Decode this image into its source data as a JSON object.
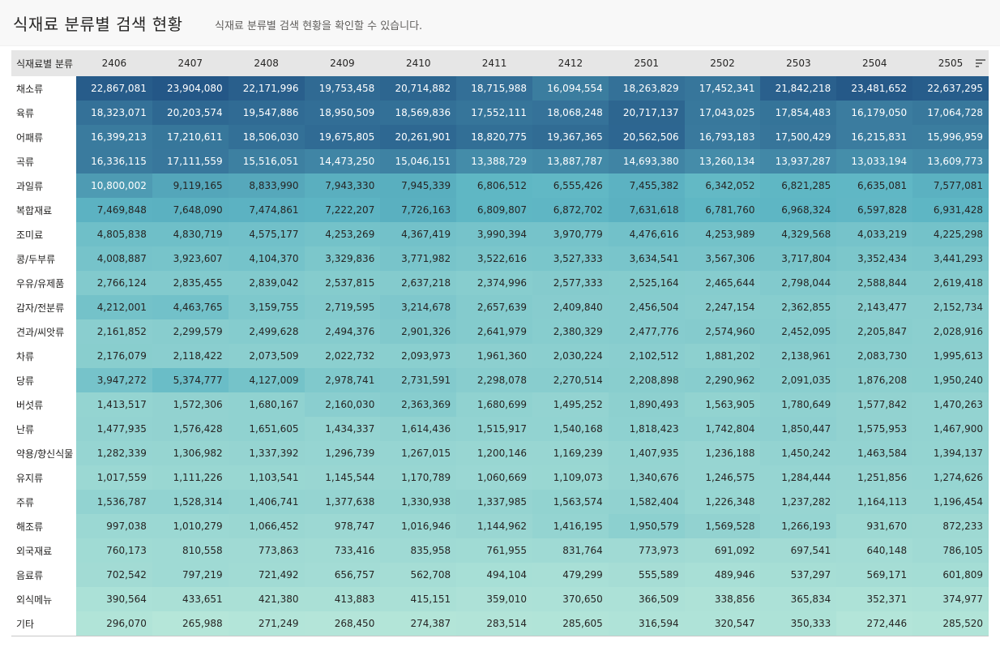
{
  "header": {
    "title": "식재료 분류별 검색 현황",
    "subtitle": "식재료 분류별 검색 현황을 확인할 수 있습니다."
  },
  "colors": {
    "low": "#b5e6d9",
    "mid": "#5eb6c4",
    "high": "#245787",
    "header_bg": "#e6e6e6"
  },
  "chart_data": {
    "type": "heatmap",
    "row_header": "식재료별 분류",
    "columns": [
      "2406",
      "2407",
      "2408",
      "2409",
      "2410",
      "2411",
      "2412",
      "2501",
      "2502",
      "2503",
      "2504",
      "2505"
    ],
    "rows": [
      {
        "label": "채소류",
        "values": [
          22867081,
          23904080,
          22171996,
          19753458,
          20714882,
          18715988,
          16094554,
          18263829,
          17452341,
          21842218,
          23481652,
          22637295
        ]
      },
      {
        "label": "육류",
        "values": [
          18323071,
          20203574,
          19547886,
          18950509,
          18569836,
          17552111,
          18068248,
          20717137,
          17043025,
          17854483,
          16179050,
          17064728
        ]
      },
      {
        "label": "어패류",
        "values": [
          16399213,
          17210611,
          18506030,
          19675805,
          20261901,
          18820775,
          19367365,
          20562506,
          16793183,
          17500429,
          16215831,
          15996959
        ]
      },
      {
        "label": "곡류",
        "values": [
          16336115,
          17111559,
          15516051,
          14473250,
          15046151,
          13388729,
          13887787,
          14693380,
          13260134,
          13937287,
          13033194,
          13609773
        ]
      },
      {
        "label": "과일류",
        "values": [
          10800002,
          9119165,
          8833990,
          7943330,
          7945339,
          6806512,
          6555426,
          7455382,
          6342052,
          6821285,
          6635081,
          7577081
        ]
      },
      {
        "label": "복합재료",
        "values": [
          7469848,
          7648090,
          7474861,
          7222207,
          7726163,
          6809807,
          6872702,
          7631618,
          6781760,
          6968324,
          6597828,
          6931428
        ]
      },
      {
        "label": "조미료",
        "values": [
          4805838,
          4830719,
          4575177,
          4253269,
          4367419,
          3990394,
          3970779,
          4476616,
          4253989,
          4329568,
          4033219,
          4225298
        ]
      },
      {
        "label": "콩/두부류",
        "values": [
          4008887,
          3923607,
          4104370,
          3329836,
          3771982,
          3522616,
          3527333,
          3634541,
          3567306,
          3717804,
          3352434,
          3441293
        ]
      },
      {
        "label": "우유/유제품",
        "values": [
          2766124,
          2835455,
          2839042,
          2537815,
          2637218,
          2374996,
          2577333,
          2525164,
          2465644,
          2798044,
          2588844,
          2619418
        ]
      },
      {
        "label": "감자/전분류",
        "values": [
          4212001,
          4463765,
          3159755,
          2719595,
          3214678,
          2657639,
          2409840,
          2456504,
          2247154,
          2362855,
          2143477,
          2152734
        ]
      },
      {
        "label": "견과/씨앗류",
        "values": [
          2161852,
          2299579,
          2499628,
          2494376,
          2901326,
          2641979,
          2380329,
          2477776,
          2574960,
          2452095,
          2205847,
          2028916
        ]
      },
      {
        "label": "차류",
        "values": [
          2176079,
          2118422,
          2073509,
          2022732,
          2093973,
          1961360,
          2030224,
          2102512,
          1881202,
          2138961,
          2083730,
          1995613
        ]
      },
      {
        "label": "당류",
        "values": [
          3947272,
          5374777,
          4127009,
          2978741,
          2731591,
          2298078,
          2270514,
          2208898,
          2290962,
          2091035,
          1876208,
          1950240
        ]
      },
      {
        "label": "버섯류",
        "values": [
          1413517,
          1572306,
          1680167,
          2160030,
          2363369,
          1680699,
          1495252,
          1890493,
          1563905,
          1780649,
          1577842,
          1470263
        ]
      },
      {
        "label": "난류",
        "values": [
          1477935,
          1576428,
          1651605,
          1434337,
          1614436,
          1515917,
          1540168,
          1818423,
          1742804,
          1850447,
          1575953,
          1467900
        ]
      },
      {
        "label": "약용/향신식물",
        "values": [
          1282339,
          1306982,
          1337392,
          1296739,
          1267015,
          1200146,
          1169239,
          1407935,
          1236188,
          1450242,
          1463584,
          1394137
        ]
      },
      {
        "label": "유지류",
        "values": [
          1017559,
          1111226,
          1103541,
          1145544,
          1170789,
          1060669,
          1109073,
          1340676,
          1246575,
          1284444,
          1251856,
          1274626
        ]
      },
      {
        "label": "주류",
        "values": [
          1536787,
          1528314,
          1406741,
          1377638,
          1330938,
          1337985,
          1563574,
          1582404,
          1226348,
          1237282,
          1164113,
          1196454
        ]
      },
      {
        "label": "해조류",
        "values": [
          997038,
          1010279,
          1066452,
          978747,
          1016946,
          1144962,
          1416195,
          1950579,
          1569528,
          1266193,
          931670,
          872233
        ]
      },
      {
        "label": "외국재료",
        "values": [
          760173,
          810558,
          773863,
          733416,
          835958,
          761955,
          831764,
          773973,
          691092,
          697541,
          640148,
          786105
        ]
      },
      {
        "label": "음료류",
        "values": [
          702542,
          797219,
          721492,
          656757,
          562708,
          494104,
          479299,
          555589,
          489946,
          537297,
          569171,
          601809
        ]
      },
      {
        "label": "외식메뉴",
        "values": [
          390564,
          433651,
          421380,
          413883,
          415151,
          359010,
          370650,
          366509,
          338856,
          365834,
          352371,
          374977
        ]
      },
      {
        "label": "기타",
        "values": [
          296070,
          265988,
          271249,
          268450,
          274387,
          283514,
          285605,
          316594,
          320547,
          350333,
          272446,
          285520
        ]
      }
    ]
  }
}
